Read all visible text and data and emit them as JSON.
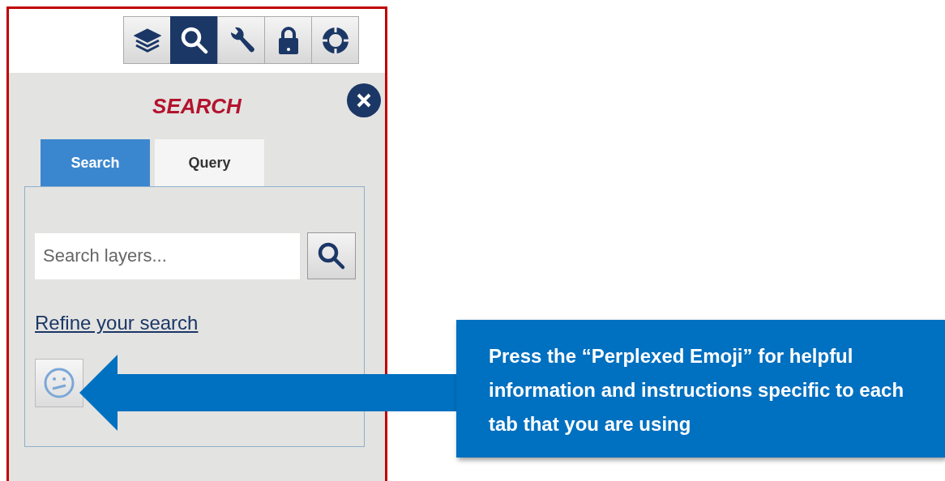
{
  "toolbar": [
    {
      "kind": "layers",
      "selected": false
    },
    {
      "kind": "search",
      "selected": true
    },
    {
      "kind": "wrench",
      "selected": false
    },
    {
      "kind": "lock",
      "selected": false
    },
    {
      "kind": "lifebuoy",
      "selected": false
    }
  ],
  "panel": {
    "title": "SEARCH",
    "tabs": [
      {
        "label": "Search",
        "selected": true
      },
      {
        "label": "Query",
        "selected": false
      }
    ],
    "search": {
      "placeholder": "Search layers..."
    },
    "link": "Refine your search"
  },
  "callout": {
    "text": "Press the “Perplexed Emoji” for helpful information and instructions specific to each tab that you are using"
  }
}
